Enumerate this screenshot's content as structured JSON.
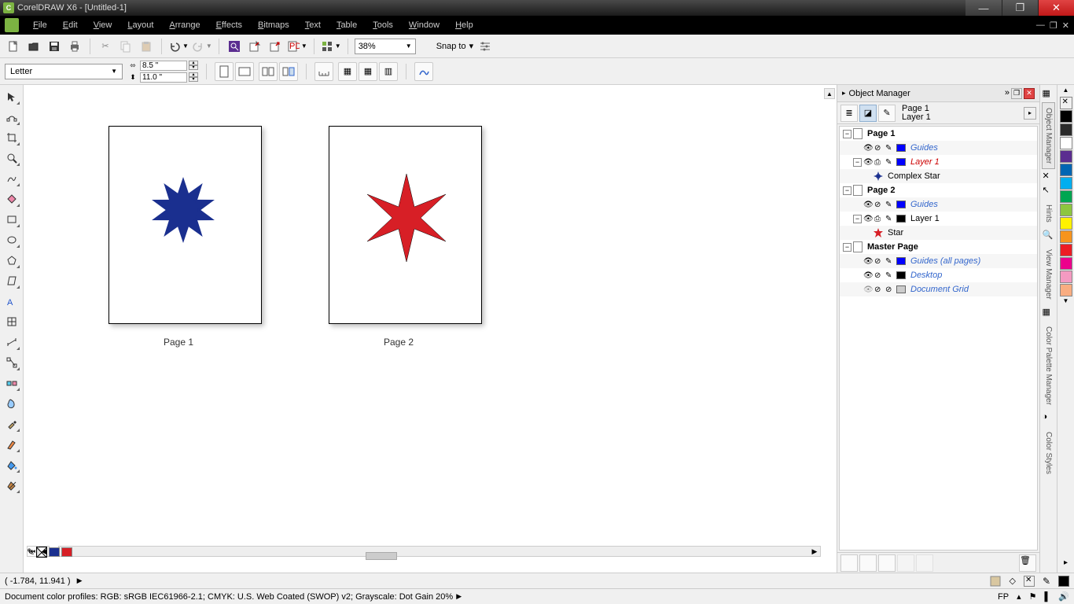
{
  "title": "CorelDRAW X6 - [Untitled-1]",
  "menu": [
    "File",
    "Edit",
    "View",
    "Layout",
    "Arrange",
    "Effects",
    "Bitmaps",
    "Text",
    "Table",
    "Tools",
    "Window",
    "Help"
  ],
  "toolbar": {
    "zoom": "38%",
    "snap_label": "Snap to"
  },
  "propbar": {
    "page_size": "Letter",
    "width": "8.5 \"",
    "height": "11.0 \""
  },
  "canvas": {
    "page1_label": "Page  1",
    "page2_label": "Page  2"
  },
  "docker": {
    "title": "Object Manager",
    "page_info_top": "Page 1",
    "page_info_bot": "Layer 1",
    "tree": {
      "page1": "Page 1",
      "guides1": "Guides",
      "layer1": "Layer 1",
      "complex_star": "Complex Star",
      "page2": "Page 2",
      "guides2": "Guides",
      "layer1b": "Layer 1",
      "star": "Star",
      "master": "Master Page",
      "guides_all": "Guides (all pages)",
      "desktop": "Desktop",
      "docgrid": "Document Grid"
    }
  },
  "side_dockers": [
    "Object Manager",
    "Hints",
    "View Manager",
    "Color Palette Manager",
    "Color Styles"
  ],
  "palette_colors": [
    "#000000",
    "#404040",
    "#ffffff",
    "#cc0000",
    "#00a651",
    "#0000ff",
    "#00aeef",
    "#ff00ff",
    "#ffff00",
    "#8b4513",
    "#ff8000",
    "#ff80c0",
    "#c0c0ff"
  ],
  "status": {
    "coords": "( -1.784, 11.941 )",
    "profiles": "Document color profiles: RGB: sRGB IEC61966-2.1; CMYK: U.S. Web Coated (SWOP) v2; Grayscale: Dot Gain 20%",
    "fp": "FP"
  }
}
